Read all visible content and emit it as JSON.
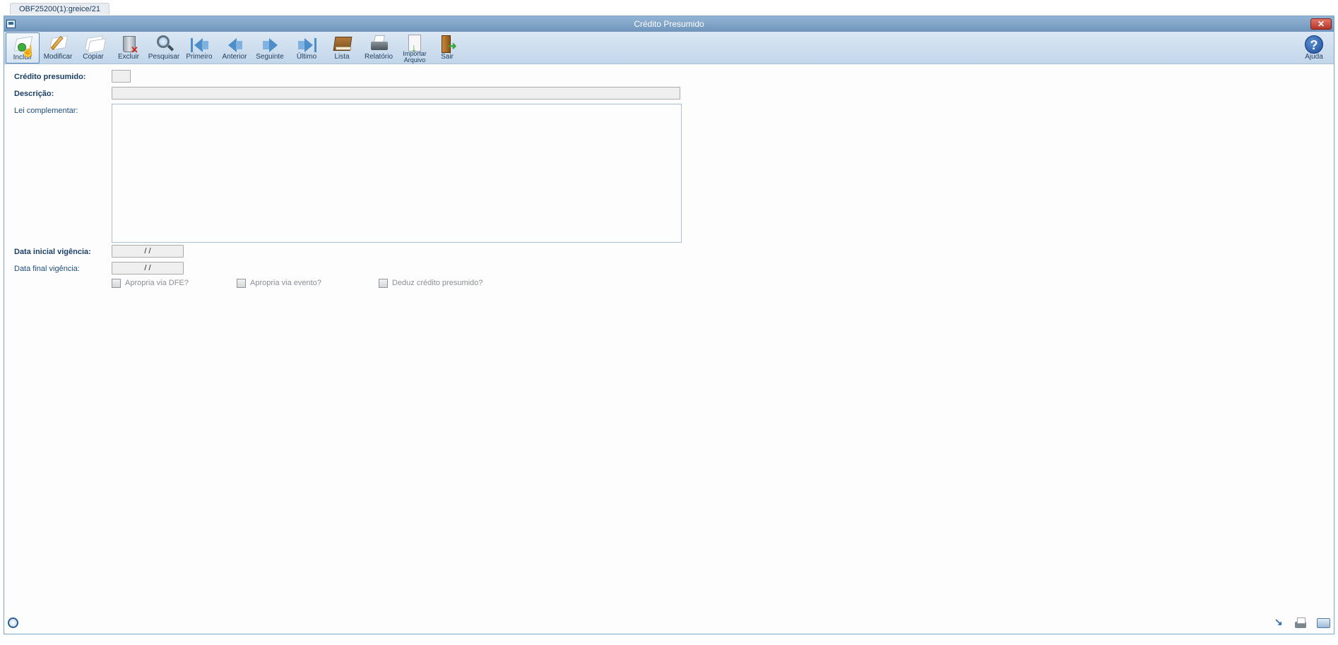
{
  "tab": {
    "label": "OBF25200(1):greice/21"
  },
  "window": {
    "title": "Crédito Presumido",
    "close_label": "✕"
  },
  "toolbar": {
    "incluir": "Incluir",
    "modificar": "Modificar",
    "copiar": "Copiar",
    "excluir": "Excluir",
    "pesquisar": "Pesquisar",
    "primeiro": "Primeiro",
    "anterior": "Anterior",
    "seguinte": "Seguinte",
    "ultimo": "Último",
    "lista": "Lista",
    "relatorio": "Relatório",
    "importar_line1": "Importar",
    "importar_line2": "Arquivo",
    "sair": "Sair",
    "ajuda": "Ajuda"
  },
  "form": {
    "credito_presumido_label": "Crédito presumido:",
    "credito_presumido_value": "",
    "descricao_label": "Descrição:",
    "descricao_value": "",
    "lei_complementar_label": "Lei complementar:",
    "lei_complementar_value": "",
    "data_inicial_label": "Data inicial vigência:",
    "data_inicial_value": " / /",
    "data_final_label": "Data final vigência:",
    "data_final_value": " / /",
    "apropria_dfe_label": "Apropria via DFE?",
    "apropria_evento_label": "Apropria via evento?",
    "deduz_credito_label": "Deduz crédito presumido?"
  },
  "icons": {
    "incluir": "add-document-icon",
    "modificar": "edit-pencil-icon",
    "copiar": "copy-documents-icon",
    "excluir": "trash-icon",
    "pesquisar": "magnifier-icon",
    "primeiro": "first-record-icon",
    "anterior": "previous-record-icon",
    "seguinte": "next-record-icon",
    "ultimo": "last-record-icon",
    "lista": "book-list-icon",
    "relatorio": "printer-icon",
    "importar": "import-file-icon",
    "sair": "exit-door-icon",
    "ajuda": "help-icon"
  }
}
